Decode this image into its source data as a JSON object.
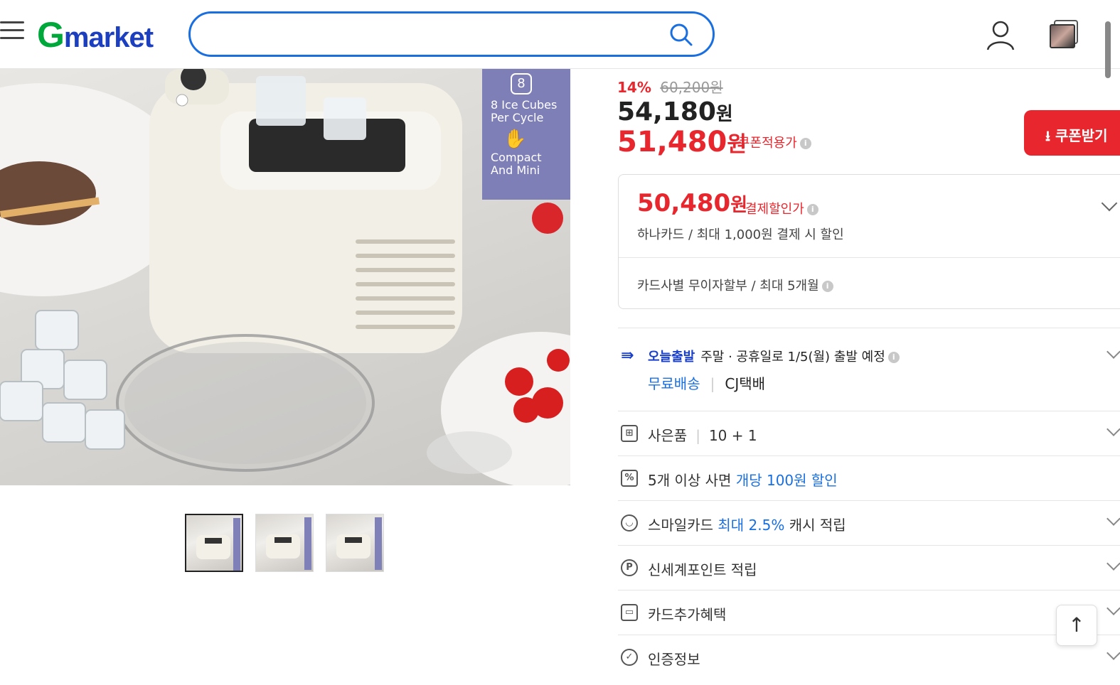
{
  "header": {
    "logo_g": "G",
    "logo_rest": "market",
    "search_placeholder": ""
  },
  "product_image": {
    "badge_number": "8",
    "badge_line1": "8 Ice Cubes",
    "badge_line2": "Per Cycle",
    "badge_line3": "Compact",
    "badge_line4": "And Mini"
  },
  "pricing": {
    "discount_pct": "14%",
    "original_price": "60,200원",
    "sale_price": "54,180",
    "sale_price_unit": "원",
    "coupon_price": "51,480",
    "coupon_price_unit": "원",
    "coupon_label": "쿠폰적용가",
    "coupon_button": "쿠폰받기"
  },
  "payment": {
    "price": "50,480",
    "price_unit": "원",
    "label": "결제할인가",
    "desc": "하나카드 / 최대 1,000원 결제 시 할인",
    "installment": "카드사별 무이자할부 / 최대 5개월"
  },
  "shipping": {
    "tag": "오늘출발",
    "text": "주말 · 공휴일로 1/5(월) 출발 예정",
    "free": "무료배송",
    "carrier": "CJ택배"
  },
  "benefits": {
    "gift_label": "사은품",
    "gift_value": "10 + 1",
    "bulk_prefix": "5개 이상 사면",
    "bulk_highlight": "개당 100원 할인",
    "smile_prefix": "스마일카드",
    "smile_highlight": "최대 2.5%",
    "smile_suffix": "캐시 적립",
    "points": "신세계포인트 적립",
    "card_extra": "카드추가혜택",
    "cert": "인증정보"
  },
  "colors": {
    "brand_green": "#00a83c",
    "brand_blue": "#1c3fbf",
    "accent_red": "#e8262d",
    "link_blue": "#1a6fe0"
  }
}
